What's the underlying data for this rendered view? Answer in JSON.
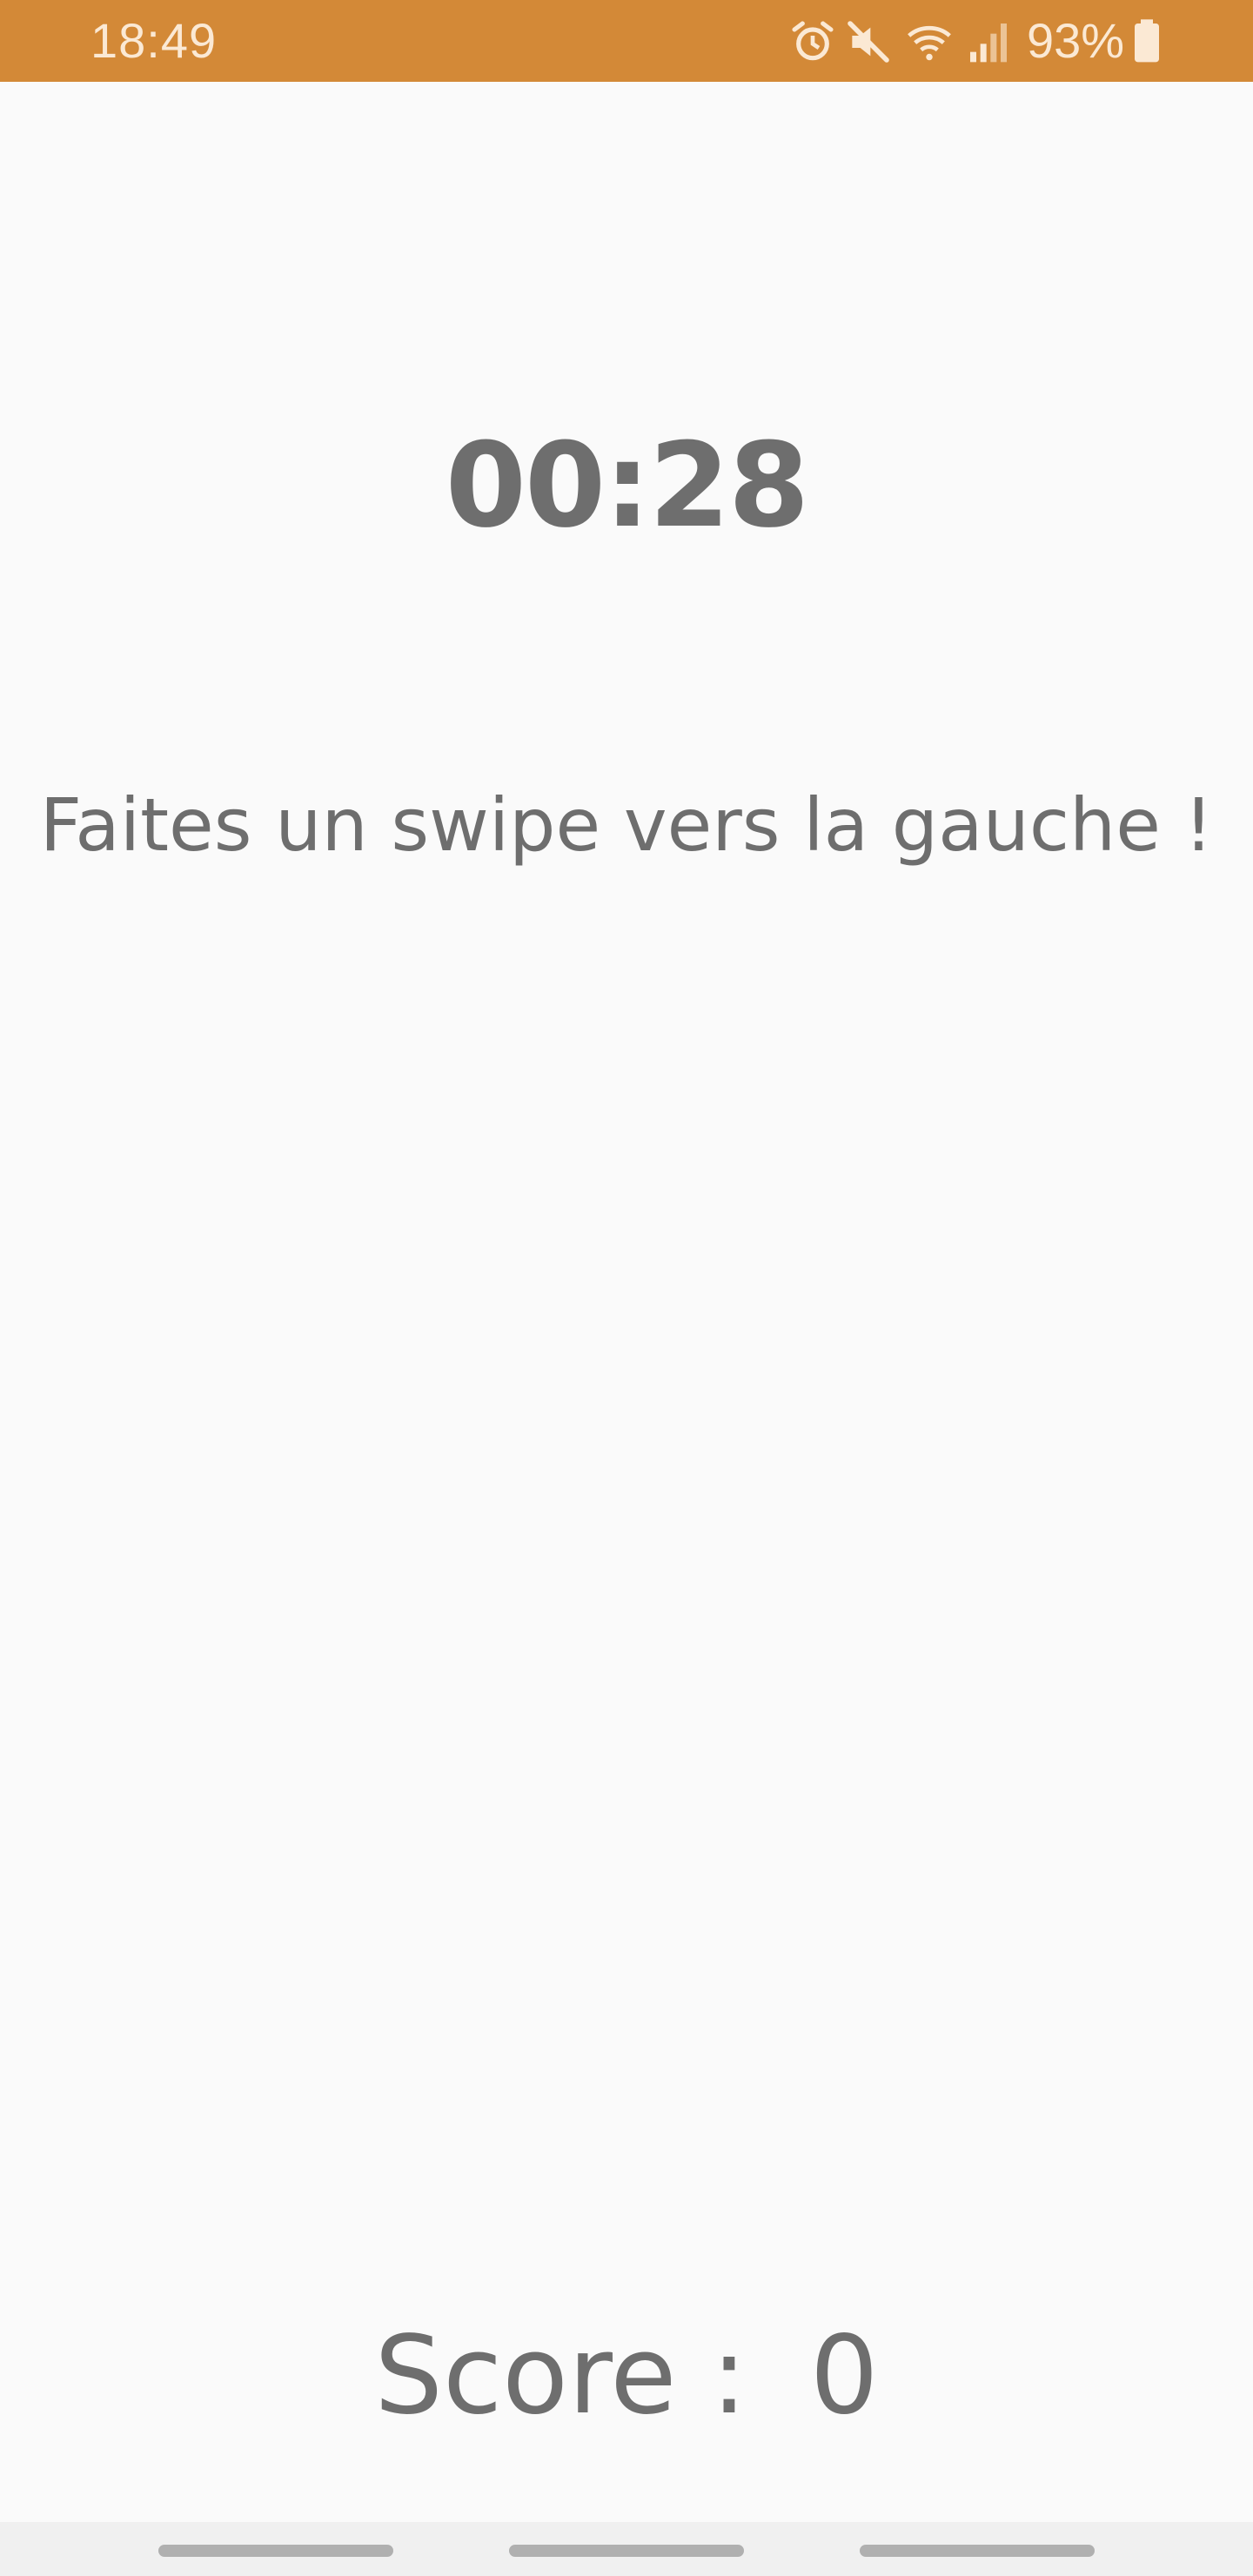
{
  "status_bar": {
    "time": "18:49",
    "battery_percent": "93%",
    "icons": [
      "alarm-icon",
      "mute-icon",
      "wifi-icon",
      "signal-icon",
      "battery-icon"
    ],
    "background_color": "#D38937"
  },
  "game": {
    "timer": "00:28",
    "instruction": "Faites un swipe vers la gauche !",
    "score_label": "Score :",
    "score_value": "0"
  },
  "navigation": {
    "handles": [
      "nav-recent",
      "nav-home",
      "nav-back"
    ]
  }
}
